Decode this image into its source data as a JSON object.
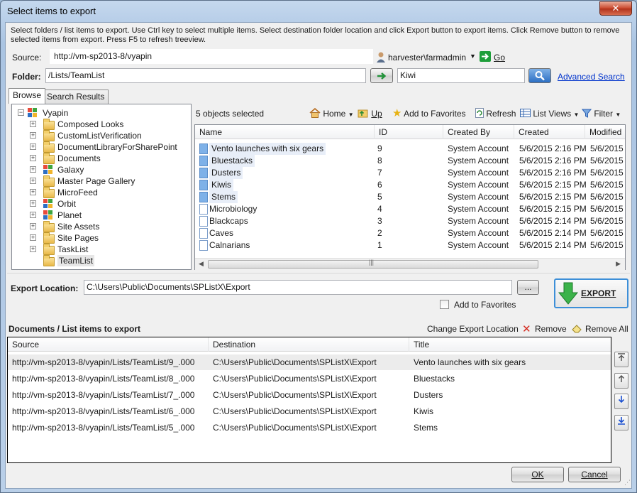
{
  "window": {
    "title": "Select items to export",
    "close_label": "✕"
  },
  "instructions": "Select folders / list items to export. Use Ctrl key to select multiple items. Select destination folder location and click Export button to export items. Click Remove button to remove selected items from export. Press F5 to refresh treeview.",
  "source": {
    "label": "Source:",
    "value": "http://vm-sp2013-8/vyapin",
    "user": "harvester\\farmadmin",
    "go_label": "Go"
  },
  "folder": {
    "label": "Folder:",
    "value": "/Lists/TeamList",
    "search_value": "Kiwi",
    "advanced_search": "Advanced Search"
  },
  "tabs": [
    "Browse",
    "Search Results"
  ],
  "tree": {
    "root": "Vyapin",
    "items": [
      {
        "label": "Composed Looks",
        "type": "folder"
      },
      {
        "label": "CustomListVerification",
        "type": "folder"
      },
      {
        "label": "DocumentLibraryForSharePoint",
        "type": "folder"
      },
      {
        "label": "Documents",
        "type": "folder"
      },
      {
        "label": "Galaxy",
        "type": "site"
      },
      {
        "label": "Master Page Gallery",
        "type": "folder"
      },
      {
        "label": "MicroFeed",
        "type": "folder"
      },
      {
        "label": "Orbit",
        "type": "site"
      },
      {
        "label": "Planet",
        "type": "site"
      },
      {
        "label": "Site Assets",
        "type": "folder"
      },
      {
        "label": "Site Pages",
        "type": "folder"
      },
      {
        "label": "TaskList",
        "type": "folder"
      },
      {
        "label": "TeamList",
        "type": "folder"
      }
    ]
  },
  "list_toolbar": {
    "status": "5 objects selected",
    "home": "Home",
    "up": "Up",
    "favorites": "Add to Favorites",
    "refresh": "Refresh",
    "list_views": "List Views",
    "filter": "Filter"
  },
  "list": {
    "columns": [
      "Name",
      "ID",
      "Created By",
      "Created",
      "Modified"
    ],
    "rows": [
      {
        "name": "Vento launches with six gears",
        "id": "9",
        "by": "System Account",
        "created": "5/6/2015 2:16 PM",
        "modified": "5/6/2015",
        "selected": true
      },
      {
        "name": "Bluestacks",
        "id": "8",
        "by": "System Account",
        "created": "5/6/2015 2:16 PM",
        "modified": "5/6/2015",
        "selected": true
      },
      {
        "name": "Dusters",
        "id": "7",
        "by": "System Account",
        "created": "5/6/2015 2:16 PM",
        "modified": "5/6/2015",
        "selected": true
      },
      {
        "name": "Kiwis",
        "id": "6",
        "by": "System Account",
        "created": "5/6/2015 2:15 PM",
        "modified": "5/6/2015",
        "selected": true
      },
      {
        "name": "Stems",
        "id": "5",
        "by": "System Account",
        "created": "5/6/2015 2:15 PM",
        "modified": "5/6/2015",
        "selected": true
      },
      {
        "name": "Microbiology",
        "id": "4",
        "by": "System Account",
        "created": "5/6/2015 2:15 PM",
        "modified": "5/6/2015",
        "selected": false
      },
      {
        "name": "Blackcaps",
        "id": "3",
        "by": "System Account",
        "created": "5/6/2015 2:14 PM",
        "modified": "5/6/2015",
        "selected": false
      },
      {
        "name": "Caves",
        "id": "2",
        "by": "System Account",
        "created": "5/6/2015 2:14 PM",
        "modified": "5/6/2015",
        "selected": false
      },
      {
        "name": "Calnarians",
        "id": "1",
        "by": "System Account",
        "created": "5/6/2015 2:14 PM",
        "modified": "5/6/2015",
        "selected": false
      }
    ]
  },
  "export": {
    "label": "Export Location:",
    "path": "C:\\Users\\Public\\Documents\\SPListX\\Export",
    "browse_label": "...",
    "add_favorites": "Add to Favorites",
    "export_button": "EXPORT"
  },
  "queue": {
    "title": "Documents / List items to export",
    "change_location": "Change Export Location",
    "remove": "Remove",
    "remove_all": "Remove All",
    "columns": [
      "Source",
      "Destination",
      "Title"
    ],
    "rows": [
      {
        "source": "http://vm-sp2013-8/vyapin/Lists/TeamList/9_.000",
        "dest": "C:\\Users\\Public\\Documents\\SPListX\\Export",
        "title": "Vento launches with six gears"
      },
      {
        "source": "http://vm-sp2013-8/vyapin/Lists/TeamList/8_.000",
        "dest": "C:\\Users\\Public\\Documents\\SPListX\\Export",
        "title": "Bluestacks"
      },
      {
        "source": "http://vm-sp2013-8/vyapin/Lists/TeamList/7_.000",
        "dest": "C:\\Users\\Public\\Documents\\SPListX\\Export",
        "title": "Dusters"
      },
      {
        "source": "http://vm-sp2013-8/vyapin/Lists/TeamList/6_.000",
        "dest": "C:\\Users\\Public\\Documents\\SPListX\\Export",
        "title": "Kiwis"
      },
      {
        "source": "http://vm-sp2013-8/vyapin/Lists/TeamList/5_.000",
        "dest": "C:\\Users\\Public\\Documents\\SPListX\\Export",
        "title": "Stems"
      }
    ]
  },
  "footer": {
    "ok": "OK",
    "cancel": "Cancel"
  }
}
